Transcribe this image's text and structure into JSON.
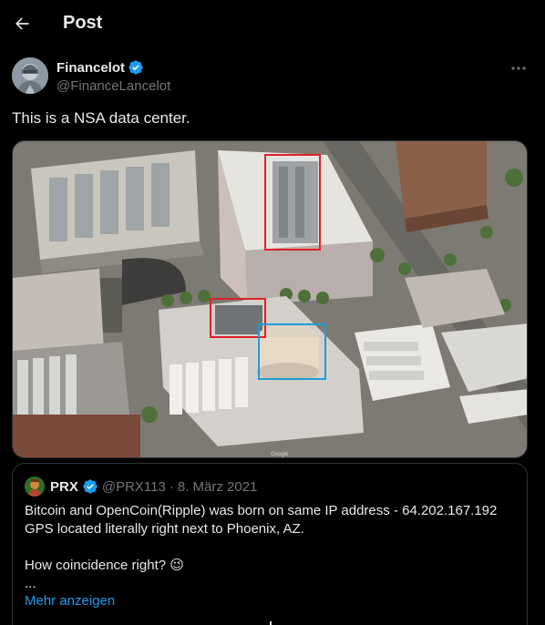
{
  "header": {
    "title": "Post"
  },
  "author": {
    "name": "Financelot",
    "handle": "@FinanceLancelot",
    "verified": true
  },
  "tweet": {
    "text": "This is a NSA data center."
  },
  "media": {
    "image_label": "Google",
    "highlight_colors": [
      "#e0202a",
      "#1f9bd8"
    ]
  },
  "quote": {
    "name": "PRX",
    "handle": "@PRX113",
    "separator": "·",
    "date": "8. März 2021",
    "lines": [
      "Bitcoin and OpenCoin(Ripple) was born on same IP address - 64.202.167.192",
      "GPS located literally right next to Phoenix, AZ.",
      "",
      "How coincidence right? 😉",
      "..."
    ],
    "show_more": "Mehr anzeigen"
  },
  "colors": {
    "background": "#000000",
    "text": "#e7e9ea",
    "muted": "#71767b",
    "accent": "#1d9bf0",
    "border": "#2f3336"
  }
}
